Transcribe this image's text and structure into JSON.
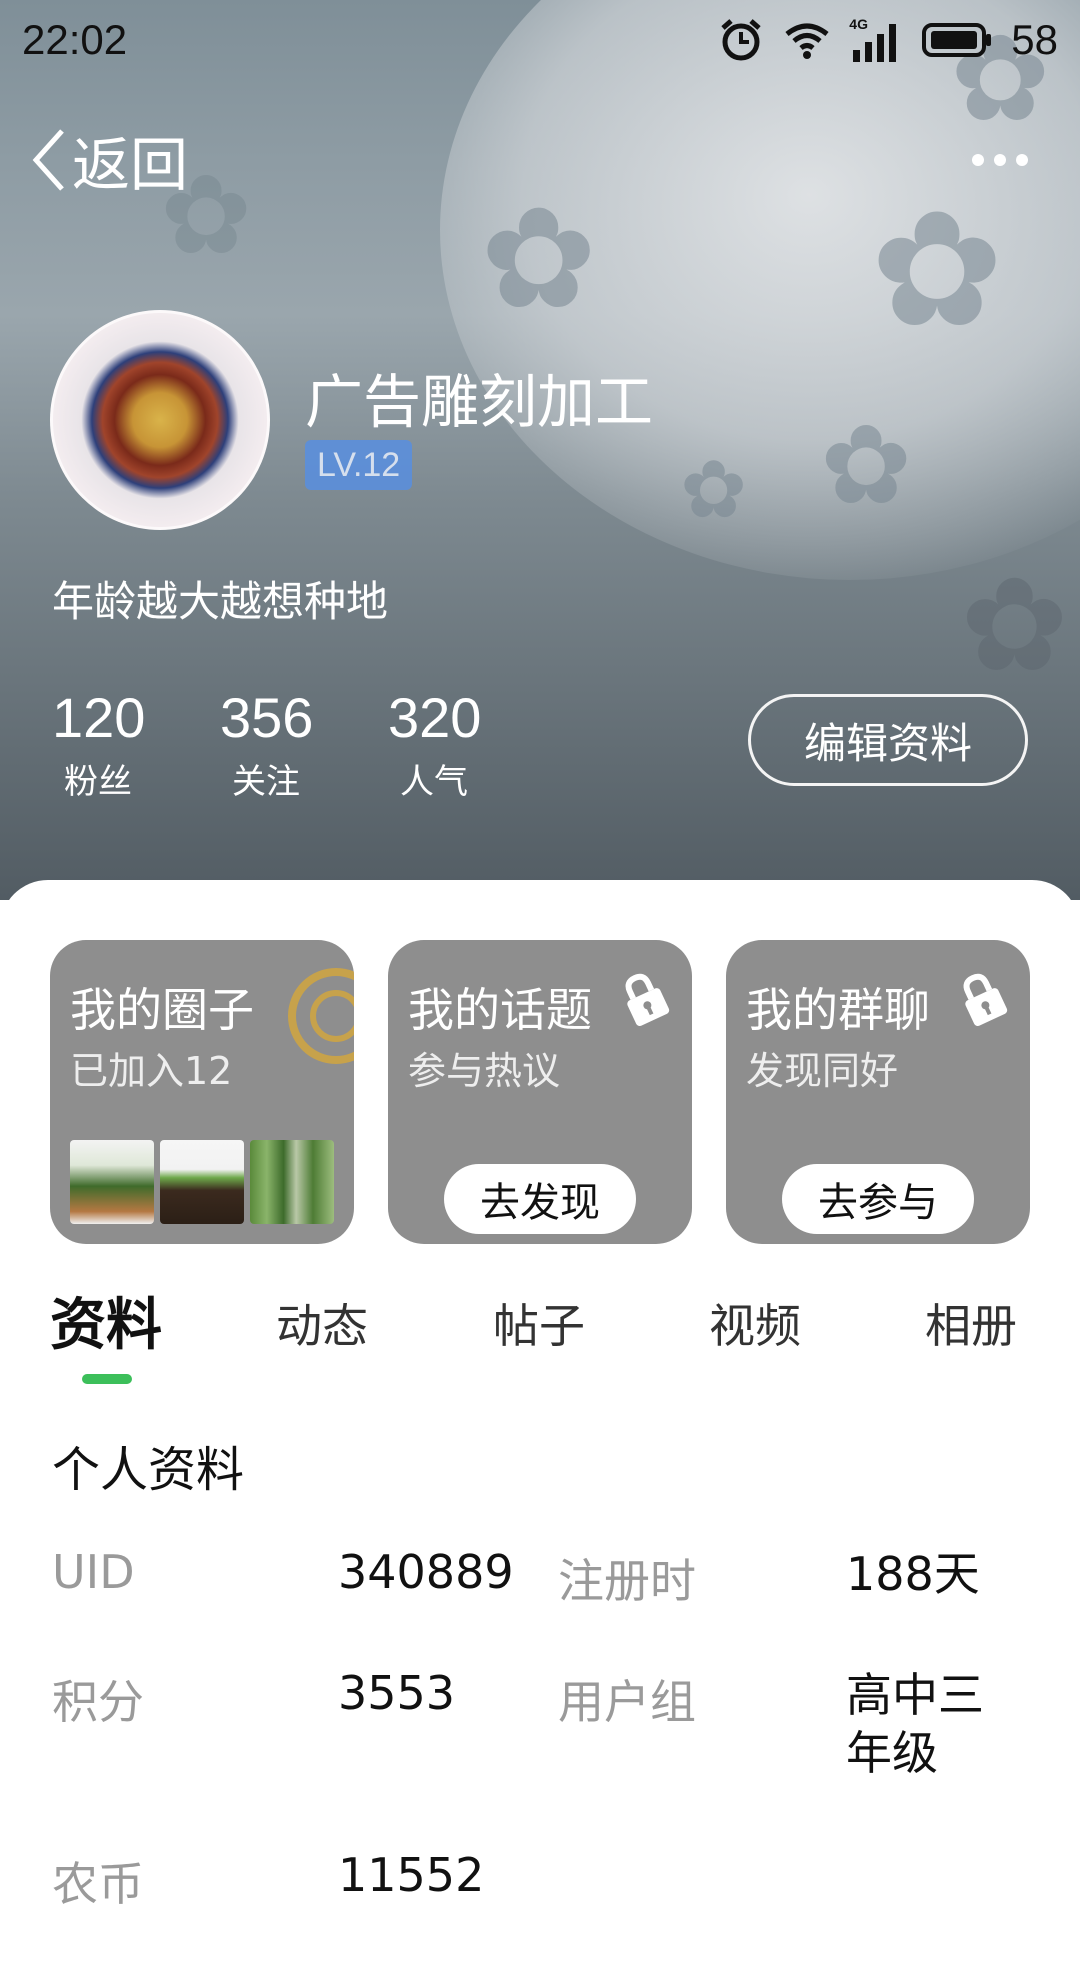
{
  "status_bar": {
    "time": "22:02",
    "battery": "58",
    "network": "4G"
  },
  "header": {
    "back_label": "返回"
  },
  "profile": {
    "nickname": "广告雕刻加工",
    "level": "LV.12",
    "bio": "年龄越大越想种地",
    "stats": [
      {
        "value": "120",
        "label": "粉丝"
      },
      {
        "value": "356",
        "label": "关注"
      },
      {
        "value": "320",
        "label": "人气"
      }
    ],
    "edit_button": "编辑资料"
  },
  "cards": [
    {
      "title": "我的圈子",
      "subtitle": "已加入12"
    },
    {
      "title": "我的话题",
      "subtitle": "参与热议",
      "button": "去发现"
    },
    {
      "title": "我的群聊",
      "subtitle": "发现同好",
      "button": "去参与"
    }
  ],
  "tabs": [
    "资料",
    "动态",
    "帖子",
    "视频",
    "相册"
  ],
  "info": {
    "section_title": "个人资料",
    "rows": [
      {
        "k1": "UID",
        "v1": "340889",
        "k2": "注册时",
        "v2": "188天"
      },
      {
        "k1": "积分",
        "v1": "3553",
        "k2": "用户组",
        "v2": "高中三年级"
      },
      {
        "k1": "农币",
        "v1": "11552"
      }
    ]
  },
  "colors": {
    "accent": "#3cbf5a",
    "level_badge": "#5b8fdc",
    "card_bg": "#8e8e8e"
  }
}
